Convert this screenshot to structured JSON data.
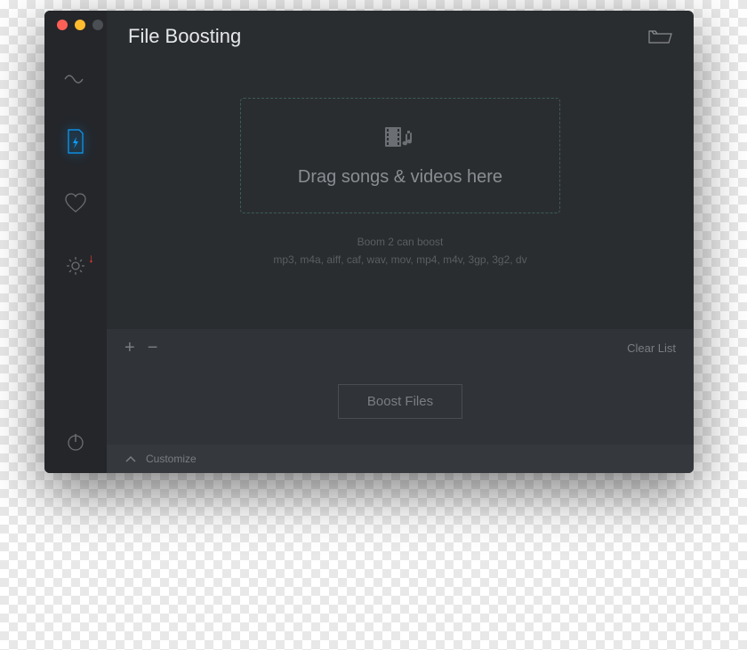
{
  "header": {
    "title": "File Boosting"
  },
  "dropzone": {
    "label": "Drag songs & videos here"
  },
  "hint": {
    "line1": "Boom 2 can boost",
    "line2": "mp3, m4a, aiff, caf, wav, mov, mp4, m4v, 3gp, 3g2, dv"
  },
  "footer": {
    "clear_label": "Clear List",
    "boost_label": "Boost Files",
    "customize_label": "Customize"
  }
}
